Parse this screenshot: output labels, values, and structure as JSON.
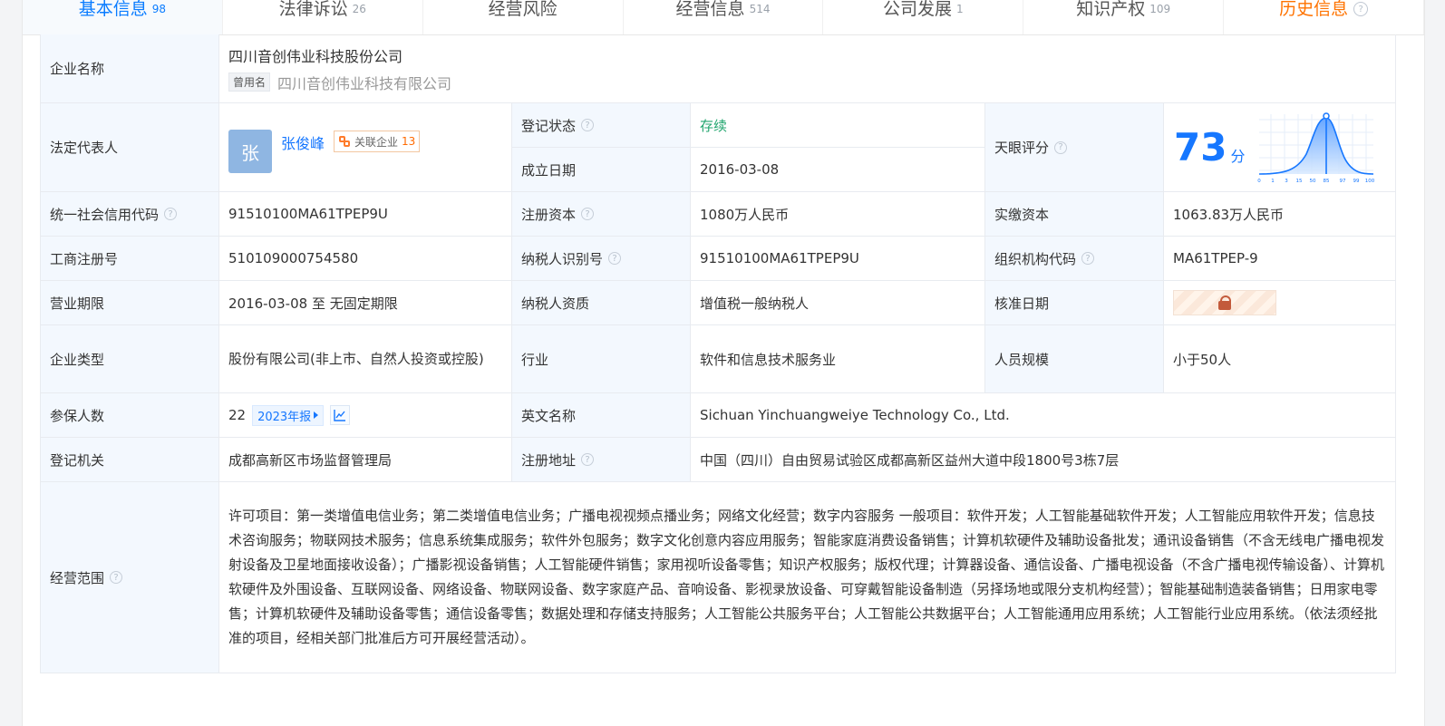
{
  "tabs": [
    {
      "label": "基本信息",
      "count": "98",
      "active": true
    },
    {
      "label": "法律诉讼",
      "count": "26",
      "active": false
    },
    {
      "label": "经营风险",
      "count": "",
      "active": false
    },
    {
      "label": "经营信息",
      "count": "514",
      "active": false
    },
    {
      "label": "公司发展",
      "count": "1",
      "active": false
    },
    {
      "label": "知识产权",
      "count": "109",
      "active": false
    },
    {
      "label": "历史信息",
      "count": "",
      "active": false
    }
  ],
  "company": {
    "name_label": "企业名称",
    "name": "四川音创伟业科技股份公司",
    "alias_tag": "曾用名",
    "alias_name": "四川音创伟业科技有限公司"
  },
  "legal": {
    "label": "法定代表人",
    "avatar": "张",
    "person": "张俊峰",
    "related_label": "关联企业",
    "related_count": "13"
  },
  "status": {
    "register_label": "登记状态",
    "register_value": "存续",
    "founded_label": "成立日期",
    "founded_value": "2016-03-08",
    "score_label": "天眼评分",
    "score_value": "73",
    "score_unit": "分"
  },
  "fields": {
    "credit_label": "统一社会信用代码",
    "credit_value": "91510100MA61TPEP9U",
    "capital_label": "注册资本",
    "capital_value": "1080万人民币",
    "paid_label": "实缴资本",
    "paid_value": "1063.83万人民币",
    "reg_label": "工商注册号",
    "reg_value": "510109000754580",
    "tax_label": "纳税人识别号",
    "tax_value": "91510100MA61TPEP9U",
    "org_label": "组织机构代码",
    "org_value": "MA61TPEP-9",
    "term_label": "营业期限",
    "term_value": "2016-03-08 至 无固定期限",
    "taxq_label": "纳税人资质",
    "taxq_value": "增值税一般纳税人",
    "approve_label": "核准日期",
    "type_label": "企业类型",
    "type_value": "股份有限公司(非上市、自然人投资或控股)",
    "industry_label": "行业",
    "industry_value": "软件和信息技术服务业",
    "staff_label": "人员规模",
    "staff_value": "小于50人",
    "insured_label": "参保人数",
    "insured_value": "22",
    "report_btn": "2023年报",
    "english_label": "英文名称",
    "english_value": "Sichuan Yinchuangweiye Technology Co., Ltd.",
    "authority_label": "登记机关",
    "authority_value": "成都高新区市场监督管理局",
    "address_label": "注册地址",
    "address_value": "中国（四川）自由贸易试验区成都高新区益州大道中段1800号3栋7层",
    "scope_label": "经营范围",
    "scope_value": "许可项目：第一类增值电信业务；第二类增值电信业务；广播电视视频点播业务；网络文化经营；数字内容服务 一般项目：软件开发；人工智能基础软件开发；人工智能应用软件开发；信息技术咨询服务；物联网技术服务；信息系统集成服务；软件外包服务；数字文化创意内容应用服务；智能家庭消费设备销售；计算机软硬件及辅助设备批发；通讯设备销售（不含无线电广播电视发射设备及卫星地面接收设备）；广播影视设备销售；人工智能硬件销售；家用视听设备零售；知识产权服务；版权代理；计算器设备、通信设备、广播电视设备（不含广播电视传输设备）、计算机软硬件及外围设备、互联网设备、网络设备、物联网设备、数字家庭产品、音响设备、影视录放设备、可穿戴智能设备制造（另择场地或限分支机构经营）；智能基础制造装备销售；日用家电零售；计算机软硬件及辅助设备零售；通信设备零售；数据处理和存储支持服务；人工智能公共服务平台；人工智能公共数据平台；人工智能通用应用系统；人工智能行业应用系统。（依法须经批准的项目，经相关部门批准后方可开展经营活动）。"
  },
  "score_chart": {
    "ticks": [
      "0",
      "1",
      "3",
      "15",
      "50",
      "85",
      "97",
      "99",
      "100"
    ]
  }
}
